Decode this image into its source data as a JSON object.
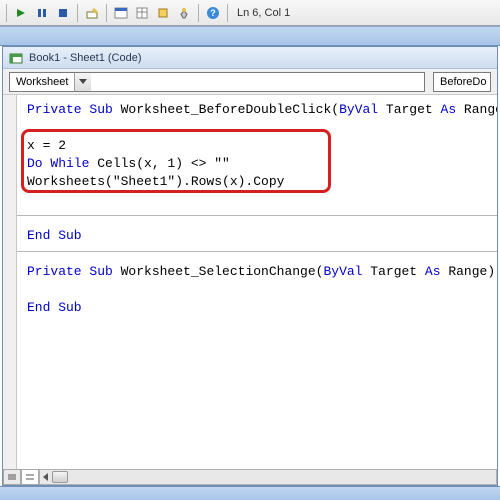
{
  "toolbar": {
    "cursor_position": "Ln 6, Col 1"
  },
  "window": {
    "title": "Book1 - Sheet1 (Code)",
    "object_selector": "Worksheet",
    "procedure_selector": "BeforeDo"
  },
  "code": {
    "line1_kw1": "Private Sub",
    "line1_name": " Worksheet_BeforeDoubleClick(",
    "line1_kw2": "ByVal",
    "line1_mid": " Target ",
    "line1_kw3": "As",
    "line1_end": " Range,",
    "blank": "",
    "line3": "x = 2",
    "line4_kw": "Do While",
    "line4_rest": " Cells(x, 1) <> \"\"",
    "line5": "Worksheets(\"Sheet1\").Rows(x).Copy",
    "line8_kw": "End Sub",
    "line10_kw1": "Private Sub",
    "line10_name": " Worksheet_SelectionChange(",
    "line10_kw2": "ByVal",
    "line10_mid": " Target ",
    "line10_kw3": "As",
    "line10_end": " Range)",
    "line12_kw": "End Sub"
  }
}
